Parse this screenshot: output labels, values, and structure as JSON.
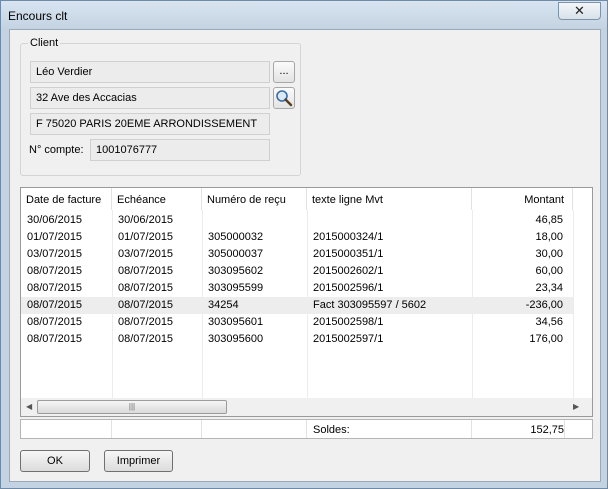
{
  "window": {
    "title": "Encours clt",
    "close_glyph": "✕"
  },
  "client": {
    "group_label": "Client",
    "name": "Léo Verdier",
    "address": "32 Ave des Accacias",
    "city": "F 75020 PARIS 20EME ARRONDISSEMENT",
    "account_label": "N° compte:",
    "account_value": "1001076777",
    "browse_label": "..."
  },
  "grid": {
    "columns": [
      "Date de facture",
      "Echéance",
      "Numéro de reçu",
      "texte ligne Mvt",
      "Montant"
    ],
    "rows": [
      [
        "30/06/2015",
        "30/06/2015",
        "",
        "",
        "46,85"
      ],
      [
        "01/07/2015",
        "01/07/2015",
        "305000032",
        "2015000324/1",
        "18,00"
      ],
      [
        "03/07/2015",
        "03/07/2015",
        "305000037",
        "2015000351/1",
        "30,00"
      ],
      [
        "08/07/2015",
        "08/07/2015",
        "303095602",
        "2015002602/1",
        "60,00"
      ],
      [
        "08/07/2015",
        "08/07/2015",
        "303095599",
        "2015002596/1",
        "23,34"
      ],
      [
        "08/07/2015",
        "08/07/2015",
        "34254",
        "Fact 303095597 / 5602",
        "-236,00"
      ],
      [
        "08/07/2015",
        "08/07/2015",
        "303095601",
        "2015002598/1",
        "34,56"
      ],
      [
        "08/07/2015",
        "08/07/2015",
        "303095600",
        "2015002597/1",
        "176,00"
      ]
    ],
    "selected_row": 5,
    "scroll_left": "◀",
    "scroll_right": "▶",
    "thumb_grip": "|||"
  },
  "totals": {
    "label": "Soldes:",
    "value": "152,75"
  },
  "buttons": {
    "ok": "OK",
    "print": "Imprimer"
  }
}
